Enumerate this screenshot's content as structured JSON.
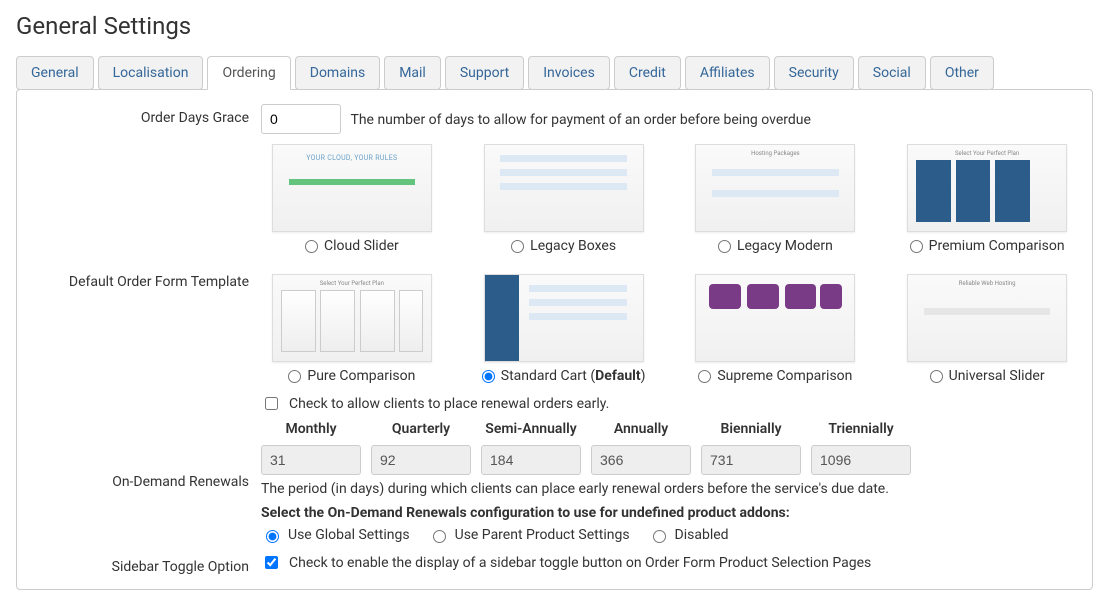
{
  "page_title": "General Settings",
  "tabs": {
    "general": "General",
    "localisation": "Localisation",
    "ordering": "Ordering",
    "domains": "Domains",
    "mail": "Mail",
    "support": "Support",
    "invoices": "Invoices",
    "credit": "Credit",
    "affiliates": "Affiliates",
    "security": "Security",
    "social": "Social",
    "other": "Other"
  },
  "order_days_grace": {
    "label": "Order Days Grace",
    "value": "0",
    "help": "The number of days to allow for payment of an order before being overdue"
  },
  "template": {
    "label": "Default Order Form Template",
    "options": {
      "cloud_slider": "Cloud Slider",
      "legacy_boxes": "Legacy Boxes",
      "legacy_modern": "Legacy Modern",
      "premium_comparison": "Premium Comparison",
      "pure_comparison": "Pure Comparison",
      "standard_cart_prefix": "Standard Cart (",
      "standard_cart_default": "Default",
      "standard_cart_suffix": ")",
      "supreme_comparison": "Supreme Comparison",
      "universal_slider": "Universal Slider"
    }
  },
  "renewals": {
    "label": "On-Demand Renewals",
    "early_checkbox": "Check to allow clients to place renewal orders early.",
    "periods": {
      "monthly": {
        "header": "Monthly",
        "value": "31"
      },
      "quarterly": {
        "header": "Quarterly",
        "value": "92"
      },
      "semi": {
        "header": "Semi-Annually",
        "value": "184"
      },
      "annually": {
        "header": "Annually",
        "value": "366"
      },
      "biennially": {
        "header": "Biennially",
        "value": "731"
      },
      "triennially": {
        "header": "Triennially",
        "value": "1096"
      }
    },
    "help": "The period (in days) during which clients can place early renewal orders before the service's due date.",
    "addon_heading": "Select the On-Demand Renewals configuration to use for undefined product addons:",
    "addon_choices": {
      "global": "Use Global Settings",
      "parent": "Use Parent Product Settings",
      "disabled": "Disabled"
    }
  },
  "sidebar_toggle": {
    "label": "Sidebar Toggle Option",
    "checkbox": "Check to enable the display of a sidebar toggle button on Order Form Product Selection Pages"
  }
}
